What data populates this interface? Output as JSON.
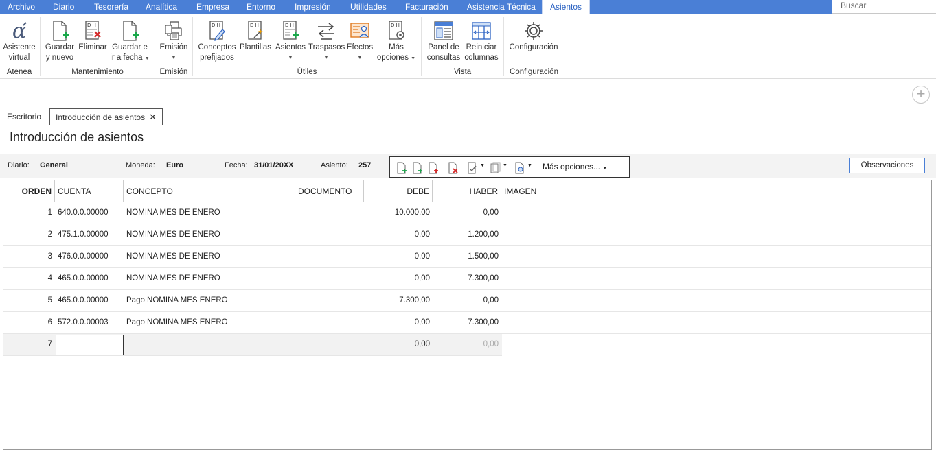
{
  "menu": {
    "items": [
      "Archivo",
      "Diario",
      "Tesorería",
      "Analítica",
      "Empresa",
      "Entorno",
      "Impresión",
      "Utilidades",
      "Facturación",
      "Asistencia Técnica",
      "Asientos"
    ],
    "search_placeholder": "Buscar"
  },
  "ribbon": {
    "buttons": {
      "asistente": "Asistente\nvirtual",
      "guardar_nuevo": "Guardar\ny nuevo",
      "eliminar": "Eliminar",
      "guardar_fecha": "Guardar e\nir a fecha",
      "emision": "Emisión",
      "conceptos": "Conceptos\nprefijados",
      "plantillas": "Plantillas",
      "asientos": "Asientos",
      "traspasos": "Traspasos",
      "efectos": "Efectos",
      "mas_opciones": "Más\nopciones",
      "panel": "Panel de\nconsultas",
      "reiniciar": "Reiniciar\ncolumnas",
      "configuracion": "Configuración"
    },
    "groups": {
      "atenea": "Atenea",
      "mantenimiento": "Mantenimiento",
      "emision": "Emisión",
      "utiles": "Útiles",
      "vista": "Vista",
      "configuracion": "Configuración"
    }
  },
  "tabs": [
    "Escritorio",
    "Introducción de asientos"
  ],
  "page_title": "Introducción de asientos",
  "info": {
    "diario_label": "Diario:",
    "diario_value": "General",
    "moneda_label": "Moneda:",
    "moneda_value": "Euro",
    "fecha_label": "Fecha:",
    "fecha_value": "31/01/20XX",
    "asiento_label": "Asiento:",
    "asiento_value": "257"
  },
  "toolbar": {
    "more_options": "Más opciones...",
    "observaciones": "Observaciones"
  },
  "table": {
    "headers": [
      "ORDEN",
      "CUENTA",
      "CONCEPTO",
      "DOCUMENTO",
      "DEBE",
      "HABER",
      "IMAGEN"
    ],
    "rows": [
      {
        "orden": "1",
        "cuenta": "640.0.0.00000",
        "concepto": "NOMINA MES DE ENERO",
        "documento": "",
        "debe": "10.000,00",
        "haber": "0,00"
      },
      {
        "orden": "2",
        "cuenta": "475.1.0.00000",
        "concepto": "NOMINA MES DE ENERO",
        "documento": "",
        "debe": "0,00",
        "haber": "1.200,00"
      },
      {
        "orden": "3",
        "cuenta": "476.0.0.00000",
        "concepto": "NOMINA MES DE ENERO",
        "documento": "",
        "debe": "0,00",
        "haber": "1.500,00"
      },
      {
        "orden": "4",
        "cuenta": "465.0.0.00000",
        "concepto": "NOMINA MES DE ENERO",
        "documento": "",
        "debe": "0,00",
        "haber": "7.300,00"
      },
      {
        "orden": "5",
        "cuenta": "465.0.0.00000",
        "concepto": "Pago NOMINA MES ENERO",
        "documento": "",
        "debe": "7.300,00",
        "haber": "0,00"
      },
      {
        "orden": "6",
        "cuenta": "572.0.0.00003",
        "concepto": "Pago NOMINA MES ENERO",
        "documento": "",
        "debe": "0,00",
        "haber": "7.300,00"
      }
    ],
    "new_row": {
      "orden": "7",
      "debe": "0,00",
      "haber": "0,00"
    }
  },
  "colors": {
    "accent": "#4a7fd6",
    "add": "#1aa84b",
    "delete": "#d62828"
  }
}
